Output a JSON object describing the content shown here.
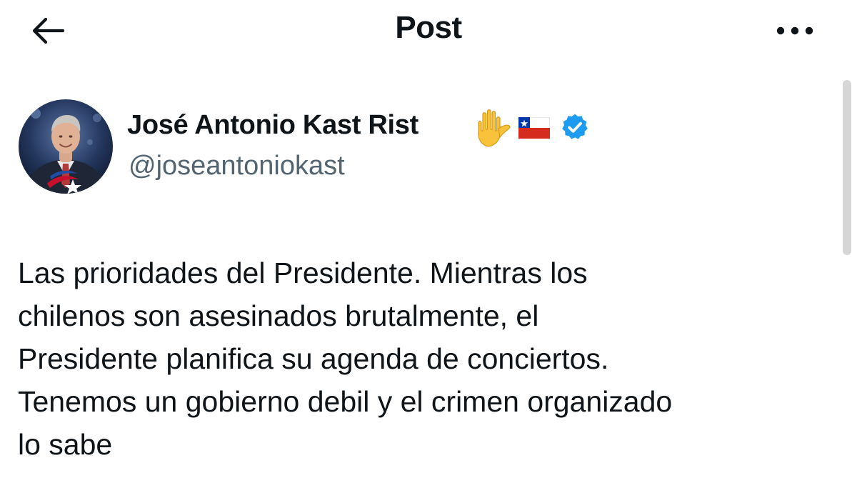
{
  "header": {
    "title": "Post",
    "back_icon": "arrow-left-icon",
    "more_icon": "more-horizontal-icon"
  },
  "author": {
    "name": "José Antonio Kast Rist",
    "handle": "@joseantoniokast",
    "name_emojis": [
      "raised-hand-emoji",
      "chile-flag-emoji"
    ],
    "verified_icon": "verified-badge-icon"
  },
  "post": {
    "lines": [
      "Las prioridades del Presidente. Mientras los",
      "chilenos son asesinados brutalmente, el",
      "Presidente planifica su agenda de conciertos.",
      "Tenemos un gobierno debil y el crimen organizado",
      "lo sabe"
    ]
  },
  "colors": {
    "text": "#0f1419",
    "secondary_text": "#536471",
    "verified_blue": "#1d9bf0",
    "background": "#ffffff"
  }
}
